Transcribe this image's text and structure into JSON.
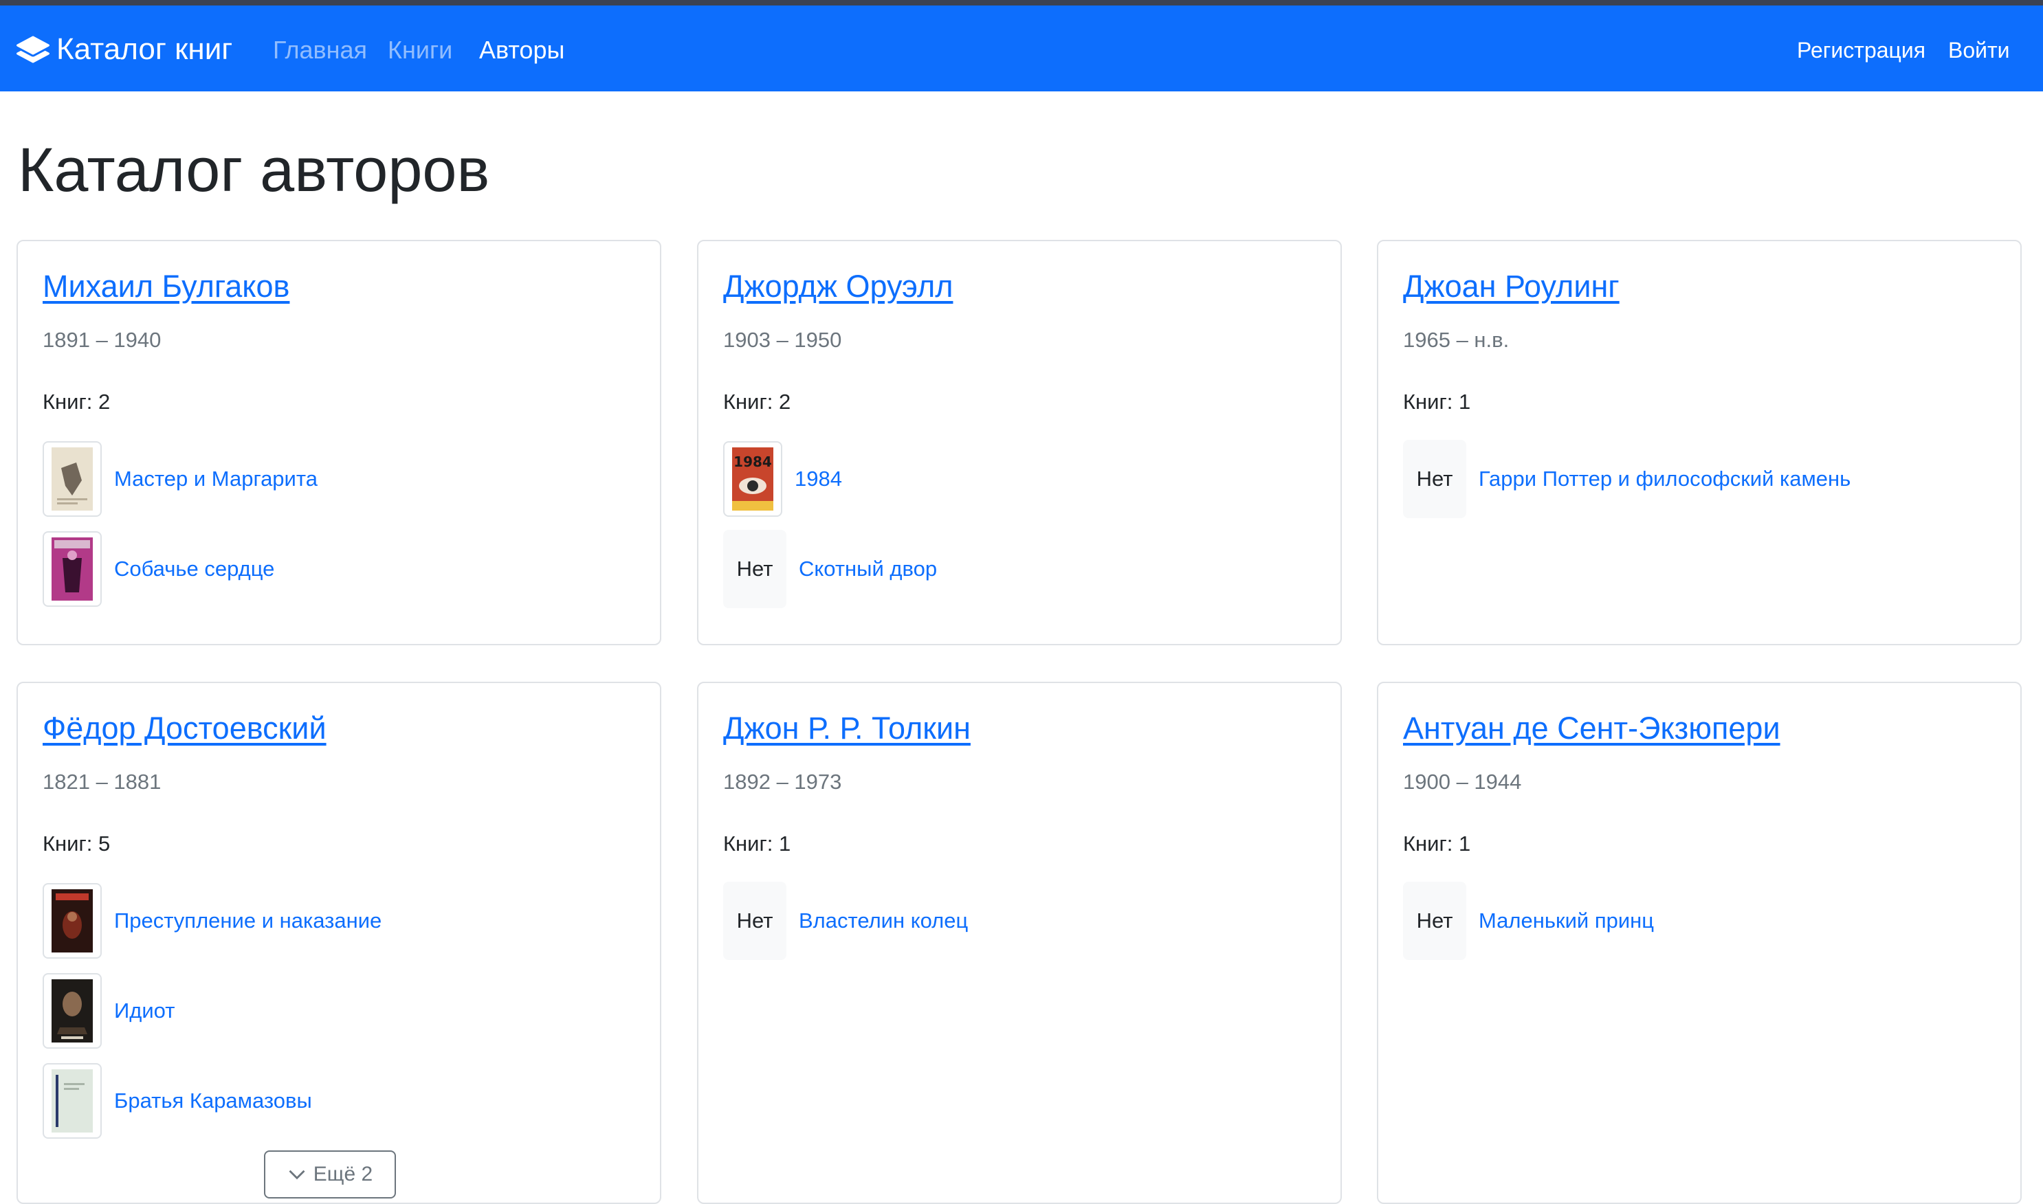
{
  "navbar": {
    "brand": "Каталог книг",
    "brand_icon": "layers-icon",
    "links": [
      "Главная",
      "Книги",
      "Авторы"
    ],
    "active_link": "Авторы",
    "register": "Регистрация",
    "login": "Войти",
    "color": "#0d6efd"
  },
  "page": {
    "title": "Каталог авторов"
  },
  "authors": [
    {
      "name": "Михаил Булгаков",
      "years": "1891 – 1940",
      "books_count": "Книг: 2",
      "books": [
        {
          "title": "Мастер и Маргарита",
          "cover": "image"
        },
        {
          "title": "Собачье сердце",
          "cover": "image"
        }
      ]
    },
    {
      "name": "Джордж Оруэлл",
      "years": "1903 – 1950",
      "books_count": "Книг: 2",
      "books": [
        {
          "title": "1984",
          "cover": "image",
          "cover_text": "1984"
        },
        {
          "title": "Скотный двор",
          "cover": "none",
          "cover_text": "Нет"
        }
      ]
    },
    {
      "name": "Джоан Роулинг",
      "years": "1965 – н.в.",
      "books_count": "Книг: 1",
      "books": [
        {
          "title": "Гарри Поттер и философский камень",
          "cover": "none",
          "cover_text": "Нет"
        }
      ]
    },
    {
      "name": "Фёдор Достоевский",
      "years": "1821 – 1881",
      "books_count": "Книг: 5",
      "books": [
        {
          "title": "Преступление и наказание",
          "cover": "image"
        },
        {
          "title": "Идиот",
          "cover": "image"
        },
        {
          "title": "Братья Карамазовы",
          "cover": "image"
        }
      ],
      "more_label": "Ещё 2"
    },
    {
      "name": "Джон Р. Р. Толкин",
      "years": "1892 – 1973",
      "books_count": "Книг: 1",
      "books": [
        {
          "title": "Властелин колец",
          "cover": "none",
          "cover_text": "Нет"
        }
      ]
    },
    {
      "name": "Антуан де Сент-Экзюпери",
      "years": "1900 – 1944",
      "books_count": "Книг: 1",
      "books": [
        {
          "title": "Маленький принц",
          "cover": "none",
          "cover_text": "Нет"
        }
      ]
    }
  ]
}
